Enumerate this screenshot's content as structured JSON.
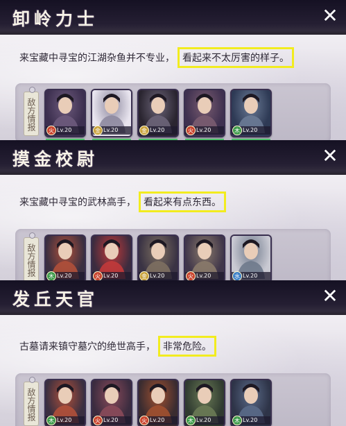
{
  "panels": [
    {
      "title": "卸岭力士",
      "description_prefix": "来宝藏中寻宝的江湖杂鱼并不专业，",
      "description_highlight": "看起来不太厉害的样子。",
      "intel_label": "敌方情报",
      "heroes": [
        {
          "element": "火",
          "element_color": "#c9452f",
          "level": "Lv.20",
          "portrait_colors": [
            "#3c2f4f",
            "#6d5a7c"
          ]
        },
        {
          "element": "金",
          "element_color": "#c8a13a",
          "level": "Lv.20",
          "portrait_colors": [
            "#e8e4ee",
            "#8e8aa0"
          ]
        },
        {
          "element": "金",
          "element_color": "#c8a13a",
          "level": "Lv.20",
          "portrait_colors": [
            "#2a2530",
            "#6b6478"
          ]
        },
        {
          "element": "火",
          "element_color": "#c9452f",
          "level": "Lv.20",
          "portrait_colors": [
            "#3f3150",
            "#7a5c70"
          ]
        },
        {
          "element": "木",
          "element_color": "#3d9a4b",
          "level": "Lv.20",
          "portrait_colors": [
            "#2e3a55",
            "#6a7a95"
          ]
        }
      ]
    },
    {
      "title": "摸金校尉",
      "description_prefix": "来宝藏中寻宝的武林高手，",
      "description_highlight": "看起来有点东西。",
      "intel_label": "敌方情报",
      "heroes": [
        {
          "element": "木",
          "element_color": "#3d9a4b",
          "level": "Lv.20",
          "portrait_colors": [
            "#3a2f40",
            "#b0503a"
          ]
        },
        {
          "element": "火",
          "element_color": "#c9452f",
          "level": "Lv.20",
          "portrait_colors": [
            "#3b2c3f",
            "#c23a3a"
          ]
        },
        {
          "element": "金",
          "element_color": "#c8a13a",
          "level": "Lv.20",
          "portrait_colors": [
            "#3a3344",
            "#7d6f60"
          ]
        },
        {
          "element": "火",
          "element_color": "#c9452f",
          "level": "Lv.20",
          "portrait_colors": [
            "#40364a",
            "#8a7a6a"
          ]
        },
        {
          "element": "水",
          "element_color": "#3b7fc8",
          "level": "Lv.20",
          "portrait_colors": [
            "#c9c9d2",
            "#6f7a8c"
          ]
        }
      ]
    },
    {
      "title": "发丘天官",
      "description_prefix": "古墓请来镇守墓穴的绝世高手，",
      "description_highlight": "非常危险。",
      "intel_label": "敌方情报",
      "heroes": [
        {
          "element": "木",
          "element_color": "#3d9a4b",
          "level": "Lv.20",
          "portrait_colors": [
            "#3a2f40",
            "#b0503a"
          ]
        },
        {
          "element": "火",
          "element_color": "#c9452f",
          "level": "Lv.20",
          "portrait_colors": [
            "#3b2c3f",
            "#8a4a5a"
          ]
        },
        {
          "element": "火",
          "element_color": "#c9452f",
          "level": "Lv.20",
          "portrait_colors": [
            "#3a2c30",
            "#a05030"
          ]
        },
        {
          "element": "木",
          "element_color": "#3d9a4b",
          "level": "Lv.20",
          "portrait_colors": [
            "#2f3a30",
            "#6a7a55"
          ]
        },
        {
          "element": "木",
          "element_color": "#3d9a4b",
          "level": "Lv.20",
          "portrait_colors": [
            "#2e3448",
            "#5a6a88"
          ]
        }
      ]
    }
  ],
  "close_icon": "close-icon",
  "highlight_color": "#f2ec1f"
}
